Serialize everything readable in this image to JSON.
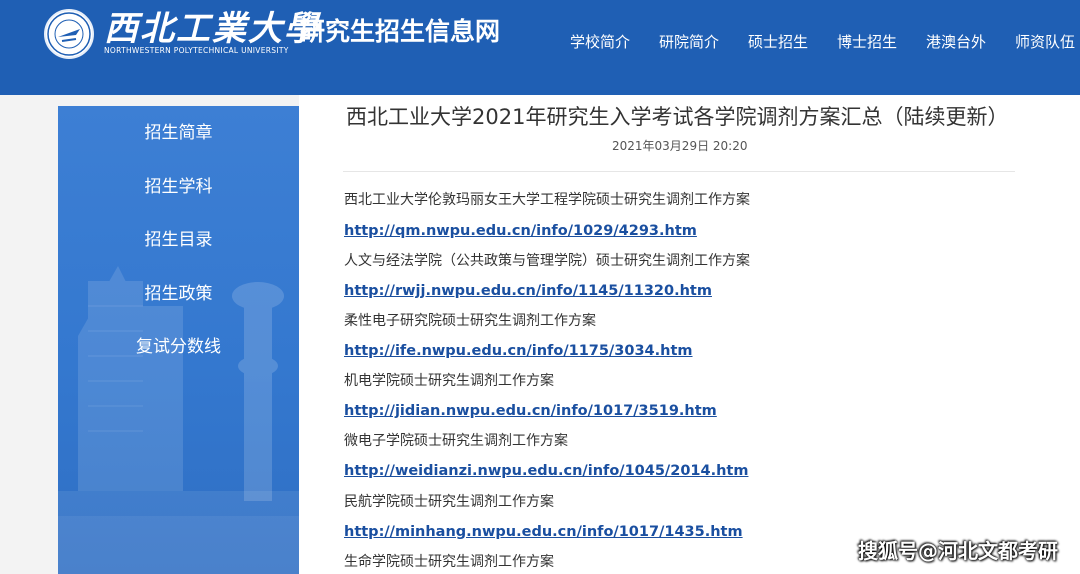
{
  "header": {
    "logo_cn": "西北工業大學",
    "logo_en": "NORTHWESTERN POLYTECHNICAL UNIVERSITY",
    "site_title": "研究生招生信息网",
    "nav": [
      "学校简介",
      "研院简介",
      "硕士招生",
      "博士招生",
      "港澳台外",
      "师资队伍"
    ]
  },
  "sidebar": {
    "items": [
      "招生简章",
      "招生学科",
      "招生目录",
      "招生政策",
      "复试分数线"
    ]
  },
  "article": {
    "title": "西北工业大学2021年研究生入学考试各学院调剂方案汇总（陆续更新）",
    "date": "2021年03月29日 20:20",
    "entries": [
      {
        "text": "西北工业大学伦敦玛丽女王大学工程学院硕士研究生调剂工作方案",
        "link": "http://qm.nwpu.edu.cn/info/1029/4293.htm"
      },
      {
        "text": "人文与经法学院（公共政策与管理学院）硕士研究生调剂工作方案",
        "link": "http://rwjj.nwpu.edu.cn/info/1145/11320.htm"
      },
      {
        "text": "柔性电子研究院硕士研究生调剂工作方案",
        "link": "http://ife.nwpu.edu.cn/info/1175/3034.htm"
      },
      {
        "text": "机电学院硕士研究生调剂工作方案",
        "link": "http://jidian.nwpu.edu.cn/info/1017/3519.htm"
      },
      {
        "text": "微电子学院硕士研究生调剂工作方案",
        "link": "http://weidianzi.nwpu.edu.cn/info/1045/2014.htm"
      },
      {
        "text": "民航学院硕士研究生调剂工作方案",
        "link": "http://minhang.nwpu.edu.cn/info/1017/1435.htm"
      },
      {
        "text": "生命学院硕士研究生调剂工作方案",
        "link": ""
      }
    ]
  },
  "watermark": "搜狐号@河北文都考研",
  "colors": {
    "header_bg": "#1f5fb4",
    "sidebar_bg": "#3478cf",
    "link": "#1a4fa0"
  }
}
